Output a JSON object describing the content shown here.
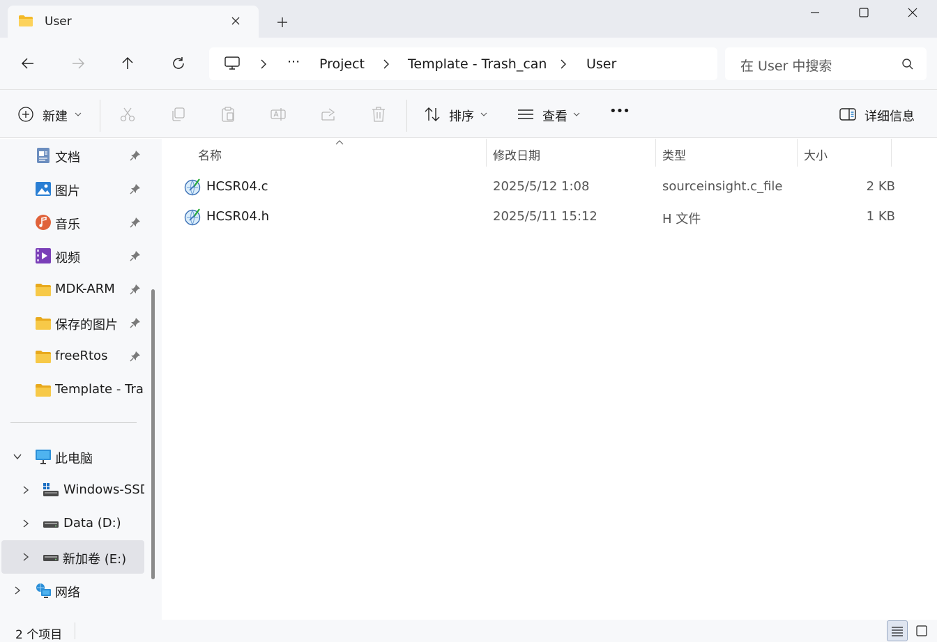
{
  "window": {
    "tab_title": "User",
    "tab_icon": "folder-icon",
    "controls": [
      "minimize-icon",
      "maximize-icon",
      "close-icon"
    ]
  },
  "address": {
    "root_icon": "this-pc-icon",
    "overflow": "···",
    "crumbs": [
      "Project",
      "Template - Trash_can",
      "User"
    ]
  },
  "search": {
    "placeholder": "在 User 中搜索"
  },
  "commandbar": {
    "new_label": "新建",
    "sort_label": "排序",
    "view_label": "查看",
    "more_label": "•••",
    "details_label": "详细信息",
    "actions": [
      "cut-icon",
      "copy-icon",
      "paste-icon",
      "rename-icon",
      "share-icon",
      "delete-icon"
    ]
  },
  "sidebar": {
    "quick_access": [
      {
        "label": "文档",
        "icon": "documents-icon",
        "pinned": true
      },
      {
        "label": "图片",
        "icon": "pictures-icon",
        "pinned": true
      },
      {
        "label": "音乐",
        "icon": "music-icon",
        "pinned": true
      },
      {
        "label": "视频",
        "icon": "videos-icon",
        "pinned": true
      },
      {
        "label": "MDK-ARM",
        "icon": "folder-icon",
        "pinned": true
      },
      {
        "label": "保存的图片",
        "icon": "folder-icon",
        "pinned": true
      },
      {
        "label": "freeRtos",
        "icon": "folder-icon",
        "pinned": true
      },
      {
        "label": "Template - Trash_can",
        "icon": "folder-icon",
        "pinned": false
      }
    ],
    "this_pc": {
      "label": "此电脑",
      "expanded": true
    },
    "drives": [
      {
        "label": "Windows-SSD (C:)",
        "icon": "windows-drive-icon",
        "selected": false
      },
      {
        "label": "Data (D:)",
        "icon": "drive-icon",
        "selected": false
      },
      {
        "label": "新加卷 (E:)",
        "icon": "drive-icon",
        "selected": true
      }
    ],
    "network": {
      "label": "网络"
    }
  },
  "filelist": {
    "columns": [
      "名称",
      "修改日期",
      "类型",
      "大小"
    ],
    "files": [
      {
        "name": "HCSR04.c",
        "modified": "2025/5/12 1:08",
        "type": "sourceinsight.c_file",
        "size": "2 KB",
        "icon": "source-insight-file-icon"
      },
      {
        "name": "HCSR04.h",
        "modified": "2025/5/11 15:12",
        "type": "H 文件",
        "size": "1 KB",
        "icon": "source-insight-file-icon"
      }
    ]
  },
  "status": {
    "item_count": "2 个项目"
  },
  "colors": {
    "chrome": "#e9ebf0",
    "panel": "#f7f8fa",
    "selected": "#e2e3e8",
    "folder": "#f7c948",
    "accent": "#0067c0"
  }
}
